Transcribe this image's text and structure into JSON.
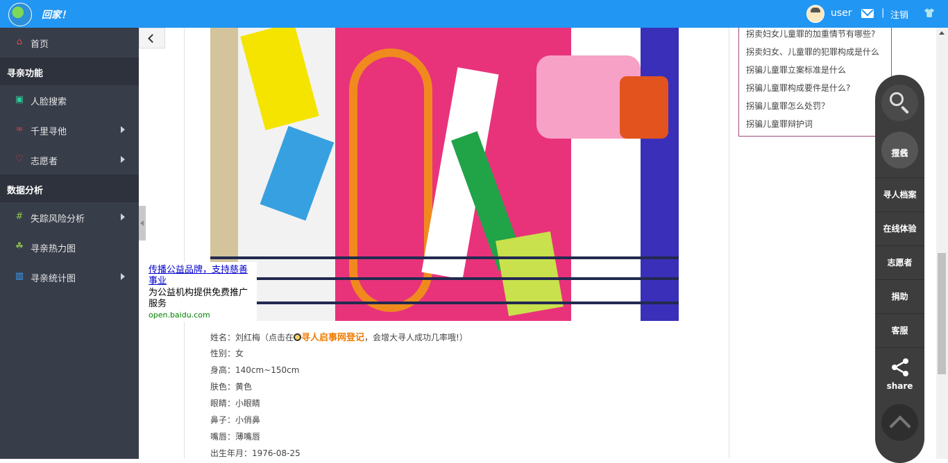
{
  "topbar": {
    "brand": "回家！",
    "username": "user",
    "separator": "|",
    "logout": "注销"
  },
  "sidebar": {
    "home": "首页",
    "section_search": "寻亲功能",
    "face_search": "人脸搜索",
    "qianli": "千里寻他",
    "volunteer": "志愿者",
    "section_analysis": "数据分析",
    "risk": "失踪风险分析",
    "heatmap": "寻亲热力图",
    "stats": "寻亲统计图"
  },
  "ad": {
    "title": "传播公益品牌，支持慈善事业",
    "desc": "为公益机构提供免费推广服务",
    "url": "open.baidu.com"
  },
  "profile": {
    "name_prefix": "姓名：刘红梅（点击在",
    "register_link": "寻人启事网登记",
    "name_suffix": "，会增大寻人成功几率哦!）",
    "gender": "性别：女",
    "height": "身高：140cm~150cm",
    "skin": "肤色：黄色",
    "eyes": "眼睛：小眼睛",
    "nose": "鼻子：小俏鼻",
    "lips": "嘴唇：薄嘴唇",
    "birth": "出生年月：1976-08-25"
  },
  "right_links": [
    "拐卖妇女儿童罪的加重情节有哪些?",
    "拐卖妇女、儿童罪的犯罪构成是什么",
    "拐骗儿童罪立案标准是什么",
    "拐骗儿童罪构成要件是什么?",
    "拐骗儿童罪怎么处罚？",
    "拐骗儿童罪辩护词"
  ],
  "float_bar": {
    "signup": "在线报名",
    "signup_l1": "在线",
    "signup_l2": "报名",
    "archive": "寻人档案",
    "experience": "在线体验",
    "volunteer": "志愿者",
    "donate": "捐助",
    "service": "客服",
    "share": "share"
  },
  "colors": {
    "topbar": "#2196f3",
    "sidebar": "#383d4a",
    "link_orange": "#f07c00"
  }
}
